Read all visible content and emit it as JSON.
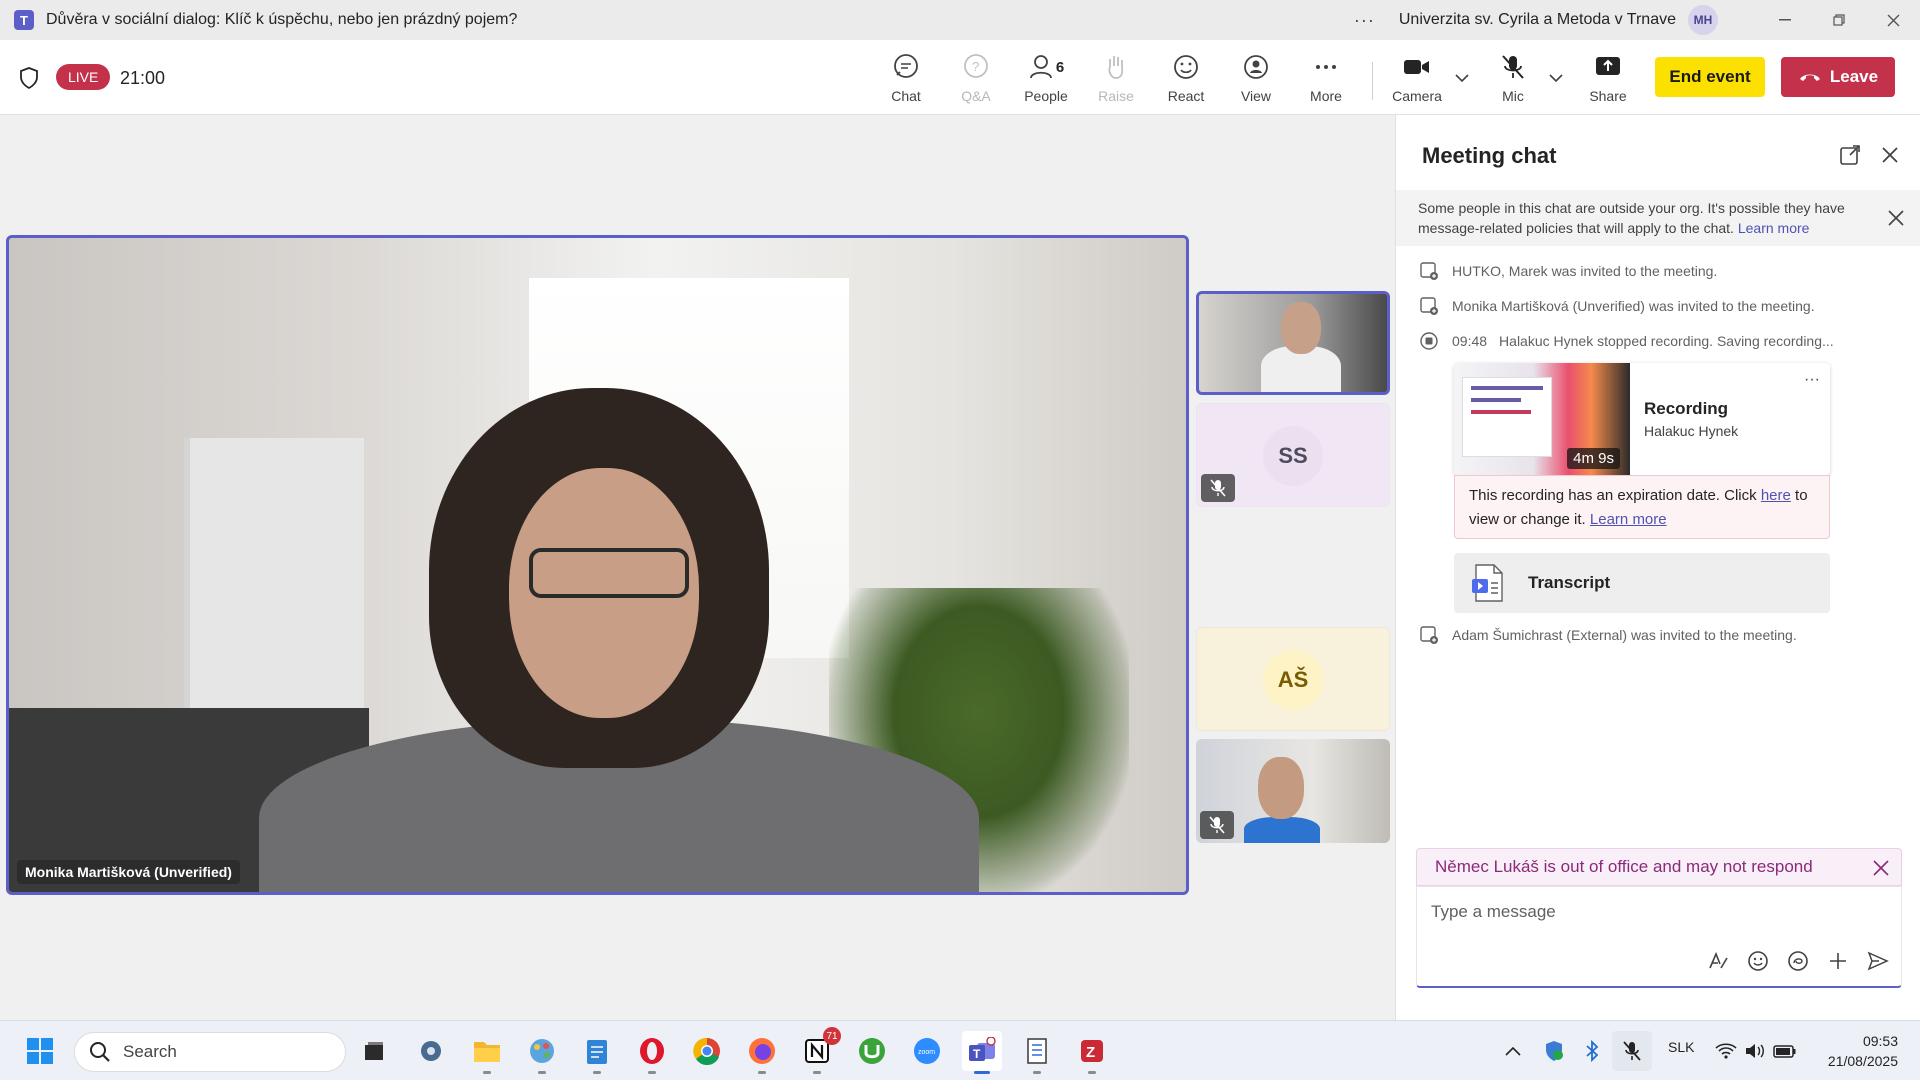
{
  "window": {
    "title": "Důvěra v sociální dialog: Klíč k úspěchu, nebo jen prázdný pojem?",
    "org": "Univerzita sv. Cyrila a Metoda v Trnave",
    "user_initials": "MH"
  },
  "meeting_bar": {
    "live_label": "LIVE",
    "timer": "21:00",
    "buttons": {
      "chat": "Chat",
      "qa": "Q&A",
      "people": "People",
      "people_count": "6",
      "raise": "Raise",
      "react": "React",
      "view": "View",
      "more": "More",
      "camera": "Camera",
      "mic": "Mic",
      "share": "Share"
    },
    "end_event": "End event",
    "leave": "Leave",
    "colors": {
      "accent": "#5b5fc7",
      "end_event_bg": "#fce100",
      "leave_bg": "#c4314b"
    }
  },
  "stage": {
    "main_name": "Monika Martišková (Unverified)",
    "tiles": [
      {
        "initials": "SS"
      },
      {
        "initials": "AŠ"
      }
    ]
  },
  "chat": {
    "title": "Meeting chat",
    "notice_text": "Some people in this chat are outside your org. It's possible they have message-related policies that will apply to the chat.",
    "notice_link": "Learn more",
    "messages": [
      {
        "text": "HUTKO, Marek was invited to the meeting."
      },
      {
        "text": "Monika Martišková (Unverified) was invited to the meeting."
      },
      {
        "time": "09:48",
        "text": "Halakuc Hynek stopped recording. Saving recording..."
      }
    ],
    "recording": {
      "title": "Recording",
      "by": "Halakuc Hynek",
      "duration": "4m 9s",
      "expiry_text_1": "This recording has an expiration date. Click",
      "expiry_link_here": "here",
      "expiry_text_2": "to view or change it.",
      "expiry_link_learn": "Learn more"
    },
    "transcript_label": "Transcript",
    "last_message": "Adam Šumichrast (External) was invited to the meeting.",
    "out_of_office": "Němec Lukáš is out of office and may not respond",
    "composer_placeholder": "Type a message"
  },
  "taskbar": {
    "search_label": "Search",
    "notion_badge": "71",
    "language": "SLK",
    "time": "09:53",
    "date": "21/08/2025"
  }
}
